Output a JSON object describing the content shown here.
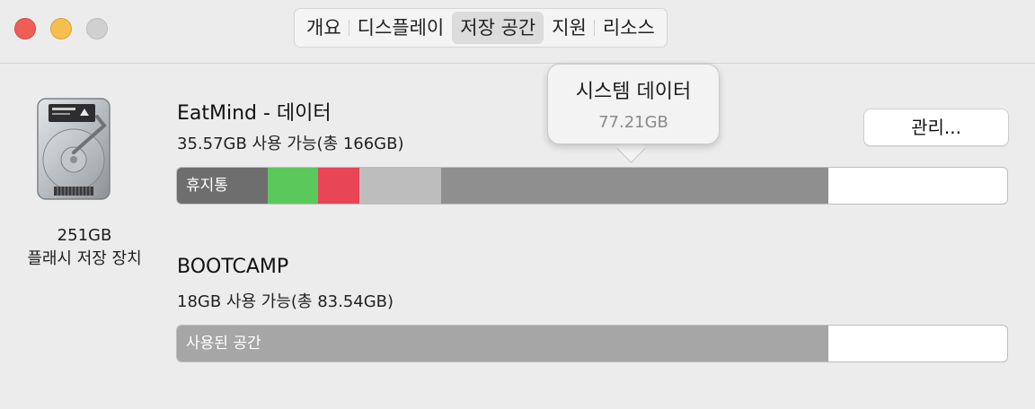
{
  "window": {
    "tabs": [
      {
        "label": "개요",
        "active": false
      },
      {
        "label": "디스플레이",
        "active": false
      },
      {
        "label": "저장 공간",
        "active": true
      },
      {
        "label": "지원",
        "active": false
      },
      {
        "label": "리소스",
        "active": false
      }
    ]
  },
  "device": {
    "icon": "hard-drive-icon",
    "capacity": "251GB",
    "type": "플래시 저장 장치"
  },
  "volumes": [
    {
      "name": "EatMind - 데이터",
      "info": "35.57GB 사용 가능(총 166GB)",
      "manage_label": "관리...",
      "segments": [
        {
          "label": "휴지통",
          "fraction": 0.109,
          "color": "#6e6e6e"
        },
        {
          "label": "",
          "fraction": 0.061,
          "color": "#5ac85a"
        },
        {
          "label": "",
          "fraction": 0.05,
          "color": "#e84557"
        },
        {
          "label": "",
          "fraction": 0.098,
          "color": "#bdbdbd"
        },
        {
          "label": "",
          "fraction": 0.467,
          "color": "#8f8f8f"
        }
      ],
      "tooltip": {
        "title": "시스템 데이터",
        "value": "77.21GB"
      }
    },
    {
      "name": "BOOTCAMP",
      "info": "18GB 사용 가능(총 83.54GB)",
      "segments": [
        {
          "label": "사용된 공간",
          "fraction": 0.785,
          "color": "#a6a6a6"
        }
      ]
    }
  ],
  "colors": {
    "traffic_close": "#ee5e57",
    "traffic_minimize": "#f5bf4f",
    "traffic_zoom": "#d0d0d0"
  }
}
